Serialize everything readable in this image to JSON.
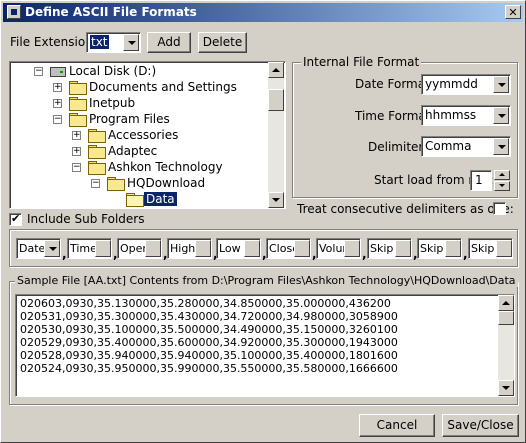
{
  "window": {
    "title": "Define ASCII File Formats",
    "close_glyph": "✕"
  },
  "toolbar": {
    "file_extension_label": "File Extension:",
    "file_extension_value": "txt",
    "add_label": "Add",
    "delete_label": "Delete"
  },
  "tree": {
    "items": [
      {
        "label": "Local Disk (D:)",
        "icon": "drive-icon",
        "expander": "−"
      },
      {
        "label": "Documents and Settings",
        "icon": "folder-icon",
        "expander": "+"
      },
      {
        "label": "Inetpub",
        "icon": "folder-icon",
        "expander": "+"
      },
      {
        "label": "Program Files",
        "icon": "folder-icon",
        "expander": "−"
      },
      {
        "label": "Accessories",
        "icon": "folder-icon",
        "expander": "+"
      },
      {
        "label": "Adaptec",
        "icon": "folder-icon",
        "expander": "+"
      },
      {
        "label": "Ashkon Technology",
        "icon": "folder-icon",
        "expander": "−"
      },
      {
        "label": "HQDownload",
        "icon": "folder-icon",
        "expander": "−"
      },
      {
        "label": "Data",
        "icon": "folder-open-icon",
        "expander": ""
      }
    ],
    "selected": "Data"
  },
  "include_sub_folders": {
    "label": "Include Sub Folders",
    "checked": true
  },
  "internal_format": {
    "group_title": "Internal File Format",
    "date_format_label": "Date Format:",
    "date_format_value": "yymmdd",
    "time_format_label": "Time Format:",
    "time_format_value": "hhmmss",
    "delimiter_label": "Delimiter:",
    "delimiter_value": "Comma",
    "start_row_label": "Start load from row:",
    "start_row_value": "1",
    "consecutive_label": "Treat consecutive delimiters as one:",
    "consecutive_checked": false
  },
  "fields": {
    "separator": ",",
    "items": [
      "Date",
      "Time",
      "Open",
      "High",
      "Low",
      "Close",
      "Volume",
      "Skip",
      "Skip",
      "Skip"
    ]
  },
  "sample": {
    "group_title": "Sample File [AA.txt] Contents from D:\\Program Files\\Ashkon Technology\\HQDownload\\Data",
    "lines": [
      "020603,0930,35.130000,35.280000,34.850000,35.000000,436200",
      "020531,0930,35.300000,35.430000,34.720000,34.980000,3058900",
      "020530,0930,35.100000,35.500000,34.490000,35.150000,3260100",
      "020529,0930,35.400000,35.600000,34.920000,35.300000,1943000",
      "020528,0930,35.940000,35.940000,35.100000,35.400000,1801600",
      "020524,0930,35.950000,35.990000,35.550000,35.580000,1666600"
    ]
  },
  "footer": {
    "cancel_label": "Cancel",
    "save_close_label": "Save/Close"
  }
}
